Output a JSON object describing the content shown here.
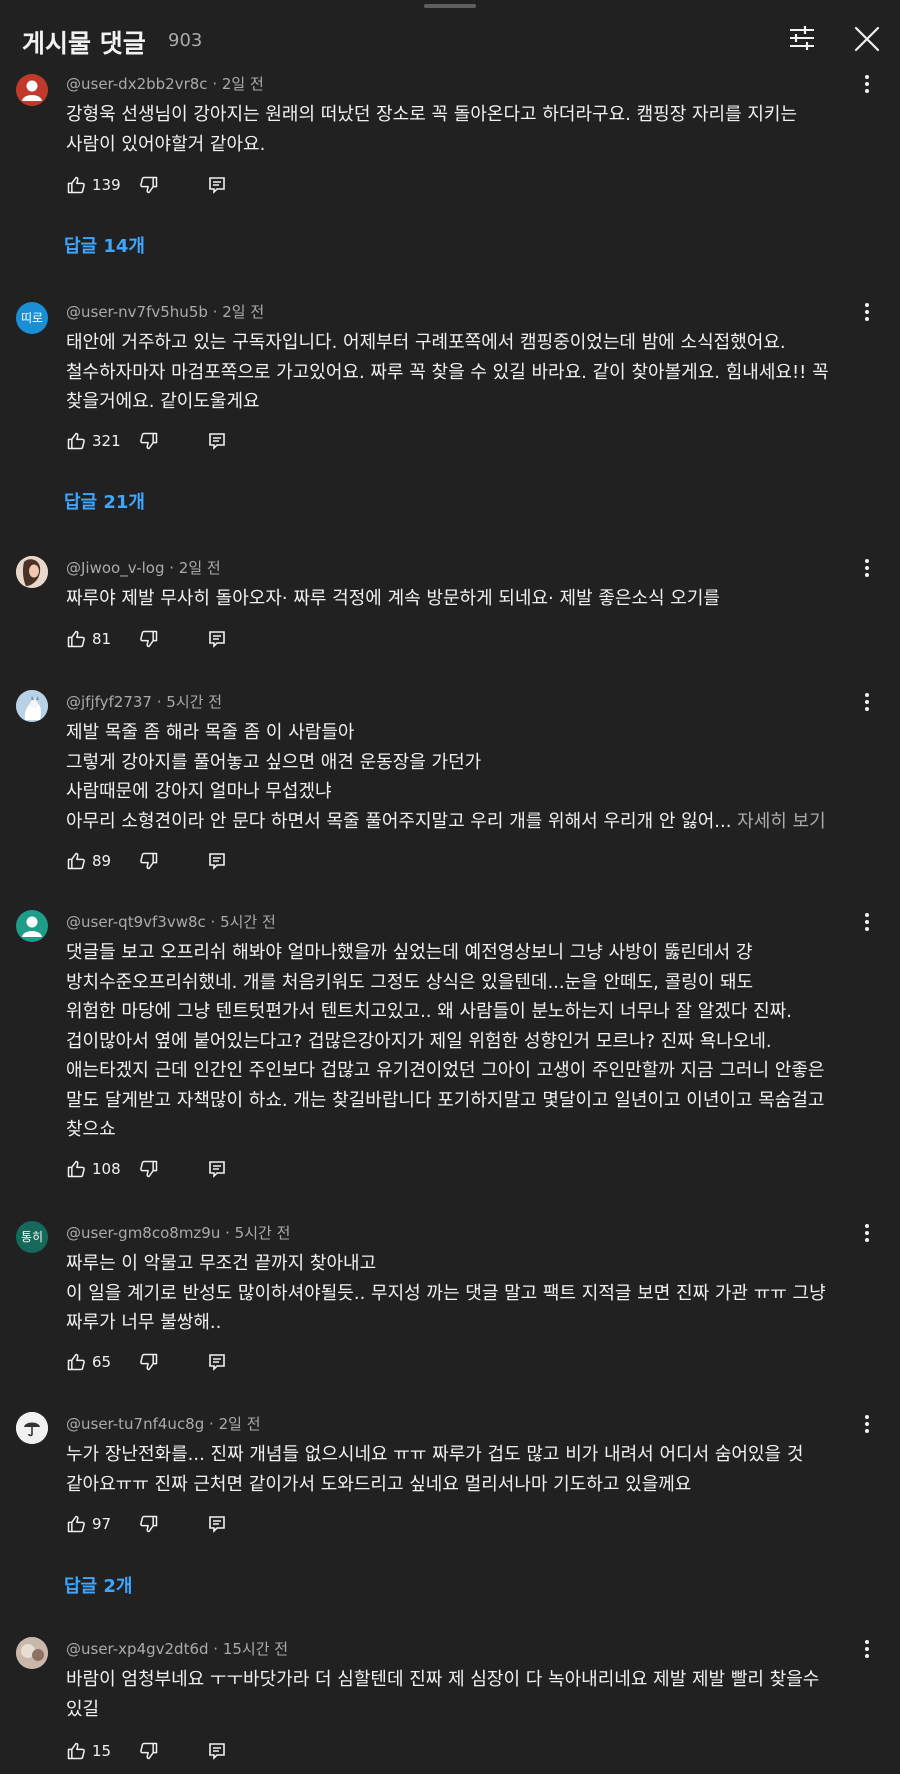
{
  "header": {
    "title": "게시물 댓글",
    "count": "903"
  },
  "colors": {
    "background": "#212121",
    "text": "#f1f1f1",
    "secondary_text": "#aaaaaa",
    "reply_link": "#3ea6ff"
  },
  "comments": [
    {
      "author": "@user-dx2bb2vr8c",
      "time": "2일 전",
      "avatar_icon": "default-user-avatar",
      "avatar_color": "#c0392b",
      "text": [
        "강형욱 선생님이 강아지는 원래의 떠났던 장소로 꼭 돌아온다고 하더라구요. 캠핑장 자리를 지키는",
        "사람이 있어야할거 같아요."
      ],
      "likes": "139",
      "replies": "답글 14개"
    },
    {
      "author": "@user-nv7fv5hu5b",
      "time": "2일 전",
      "avatar_text": "띠로",
      "avatar_color": "#1a8fd6",
      "text": [
        "태안에 거주하고 있는 구독자입니다. 어제부터 구례포쪽에서 캠핑중이었는데 밤에 소식접했어요.",
        "철수하자마자 마검포쪽으로 가고있어요. 짜루 꼭 찾을 수 있길 바라요. 같이 찾아볼게요. 힘내세요!! 꼭",
        "찾을거에요. 같이도울게요"
      ],
      "likes": "321",
      "replies": "답글 21개"
    },
    {
      "author": "@Jiwoo_v-log",
      "time": "2일 전",
      "avatar_icon": "photo-avatar",
      "avatar_color": "#8a6a5a",
      "text": [
        "짜루야 제발 무사히 돌아오자·  짜루 걱정에 계속 방문하게 되네요· 제발 좋은소식 오기를"
      ],
      "likes": "81"
    },
    {
      "author": "@jfjfyf2737",
      "time": "5시간 전",
      "avatar_icon": "cat-avatar",
      "avatar_color": "#7fa8c9",
      "text": [
        "제발 목줄 좀 해라 목줄 좀 이 사람들아",
        "그렇게 강아지를 풀어놓고 싶으면 애견 운동장을 가던가",
        "사람때문에 강아지 얼마나 무섭겠냐",
        "아무리 소형견이라 안 문다 하면서 목줄 풀어주지말고 우리 개를 위해서 우리개 안 잃어..."
      ],
      "more_label": "자세히 보기",
      "likes": "89"
    },
    {
      "author": "@user-qt9vf3vw8c",
      "time": "5시간 전",
      "avatar_icon": "default-user-avatar",
      "avatar_color": "#1e9e8a",
      "text": [
        "댓글들 보고 오프리쉬 해봐야 얼마나했을까 싶었는데 예전영상보니 그냥 사방이 뚫린데서 걍",
        "방치수준오프리쉬했네. 개를 처음키워도 그정도 상식은 있을텐데...눈을 안떼도, 콜링이 돼도",
        "위험한 마당에 그냥 텐트텃편가서 텐트치고있고.. 왜 사람들이 분노하는지 너무나 잘 알겠다 진짜.",
        "겁이많아서 옆에 붙어있는다고? 겁많은강아지가 제일 위험한 성향인거 모르나? 진짜 욕나오네.",
        "애는타겠지 근데 인간인 주인보다 겁많고 유기견이었던  그아이 고생이 주인만할까 지금 그러니 안좋은",
        "말도 달게받고 자책많이 하쇼. 개는 찾길바랍니다 포기하지말고 몇달이고 일년이고 이년이고 목숨걸고",
        "찾으쇼"
      ],
      "likes": "108"
    },
    {
      "author": "@user-gm8co8mz9u",
      "time": "5시간 전",
      "avatar_text": "통히",
      "avatar_color": "#16695a",
      "text": [
        "짜루는 이 악물고 무조건 끝까지 찾아내고",
        "이 일을 계기로 반성도 많이하셔야될듯.. 무지성 까는 댓글 말고 팩트 지적글 보면 진짜 가관 ㅠㅠ 그냥",
        "짜루가 너무 불쌍해.."
      ],
      "likes": "65"
    },
    {
      "author": "@user-tu7nf4uc8g",
      "time": "2일 전",
      "avatar_icon": "umbrella-avatar",
      "avatar_color": "#f1f1f1",
      "text": [
        "누가 장난전화를... 진짜 개념들 없으시네요 ㅠㅠ 짜루가 겁도 많고 비가 내려서 어디서 숨어있을 것",
        "같아요ㅠㅠ 진짜 근처면 같이가서 도와드리고 싶네요 멀리서나마 기도하고 있을께요"
      ],
      "likes": "97",
      "replies": "답글 2개"
    },
    {
      "author": "@user-xp4gv2dt6d",
      "time": "15시간 전",
      "avatar_icon": "photo-avatar",
      "avatar_color": "#9a8577",
      "text": [
        "바람이 엄청부네요 ㅜㅜ바닷가라 더 심할텐데 진짜 제 심장이 다 녹아내리네요  제발 제발 빨리 찾을수",
        "있길"
      ],
      "likes": "15"
    }
  ]
}
